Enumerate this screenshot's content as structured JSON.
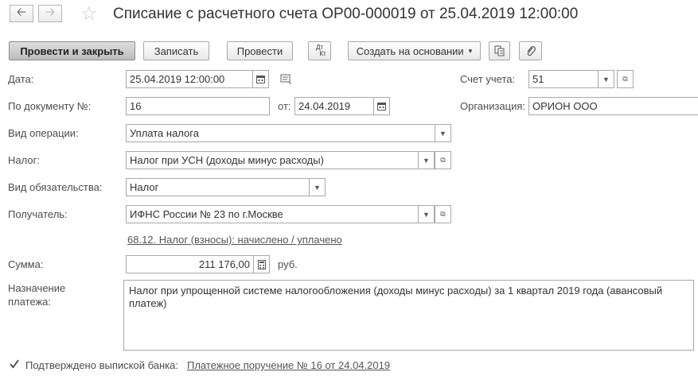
{
  "header": {
    "title": "Списание с расчетного счета ОР00-000019 от 25.04.2019 12:00:00",
    "back_icon": "arrow-left-icon",
    "forward_icon": "arrow-right-icon",
    "favorite_icon": "star-icon"
  },
  "toolbar": {
    "post_close_label": "Провести и закрыть",
    "save_label": "Записать",
    "post_label": "Провести",
    "dtkt_top": "Дт",
    "dtkt_bottom": "Кт",
    "create_based_label": "Создать на основании",
    "create_based_arrow": "▾"
  },
  "form": {
    "date_label": "Дата:",
    "date_value": "25.04.2019 12:00:00",
    "doc_no_label": "По документу №:",
    "doc_no_value": "16",
    "from_label": "от:",
    "from_value": "24.04.2019",
    "operation_label": "Вид операции:",
    "operation_value": "Уплата налога",
    "tax_label": "Налог:",
    "tax_value": "Налог при УСН (доходы минус расходы)",
    "liability_label": "Вид обязательства:",
    "liability_value": "Налог",
    "recipient_label": "Получатель:",
    "recipient_value": "ИФНС России № 23 по г.Москве",
    "account_link": "68.12. Налог (взносы): начислено / уплачено",
    "sum_label": "Сумма:",
    "sum_value": "211 176,00",
    "currency": "руб.",
    "purpose_label_1": "Назначение",
    "purpose_label_2": "платежа:",
    "purpose_value": "Налог при упрощенной системе налогообложения (доходы минус расходы) за 1 квартал 2019 года (авансовый платеж)",
    "account_label": "Счет учета:",
    "account_value": "51",
    "org_label": "Организация:",
    "org_value": "ОРИОН ООО",
    "confirmed_label": "Подтверждено выпиской банка:",
    "confirmed_checked": true,
    "payment_order_link": "Платежное поручение № 16 от 24.04.2019"
  }
}
